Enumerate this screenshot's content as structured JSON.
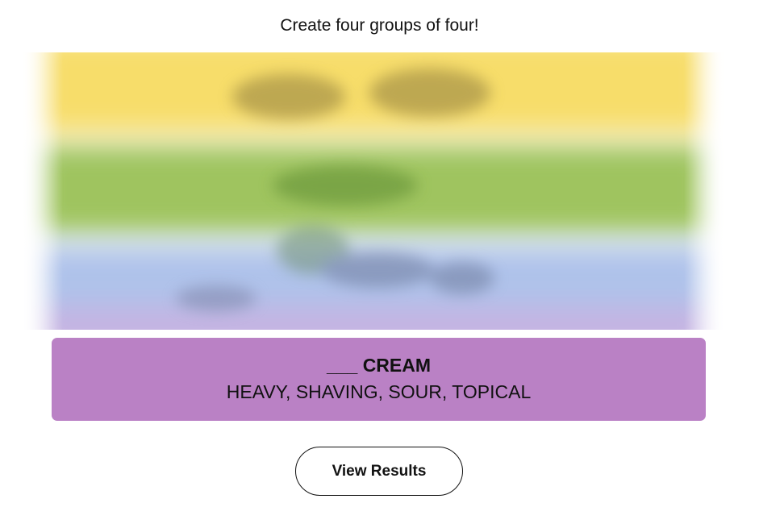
{
  "header": {
    "instructions": "Create four groups of four!"
  },
  "board": {
    "state": "blurred",
    "row_colors": [
      "#f9df6d",
      "#a0c35a",
      "#b0c4ef",
      "#ba81c5"
    ]
  },
  "solved_group": {
    "title": "___ CREAM",
    "members": "HEAVY, SHAVING, SOUR, TOPICAL",
    "color": "#ba81c5"
  },
  "actions": {
    "view_results_label": "View Results"
  }
}
